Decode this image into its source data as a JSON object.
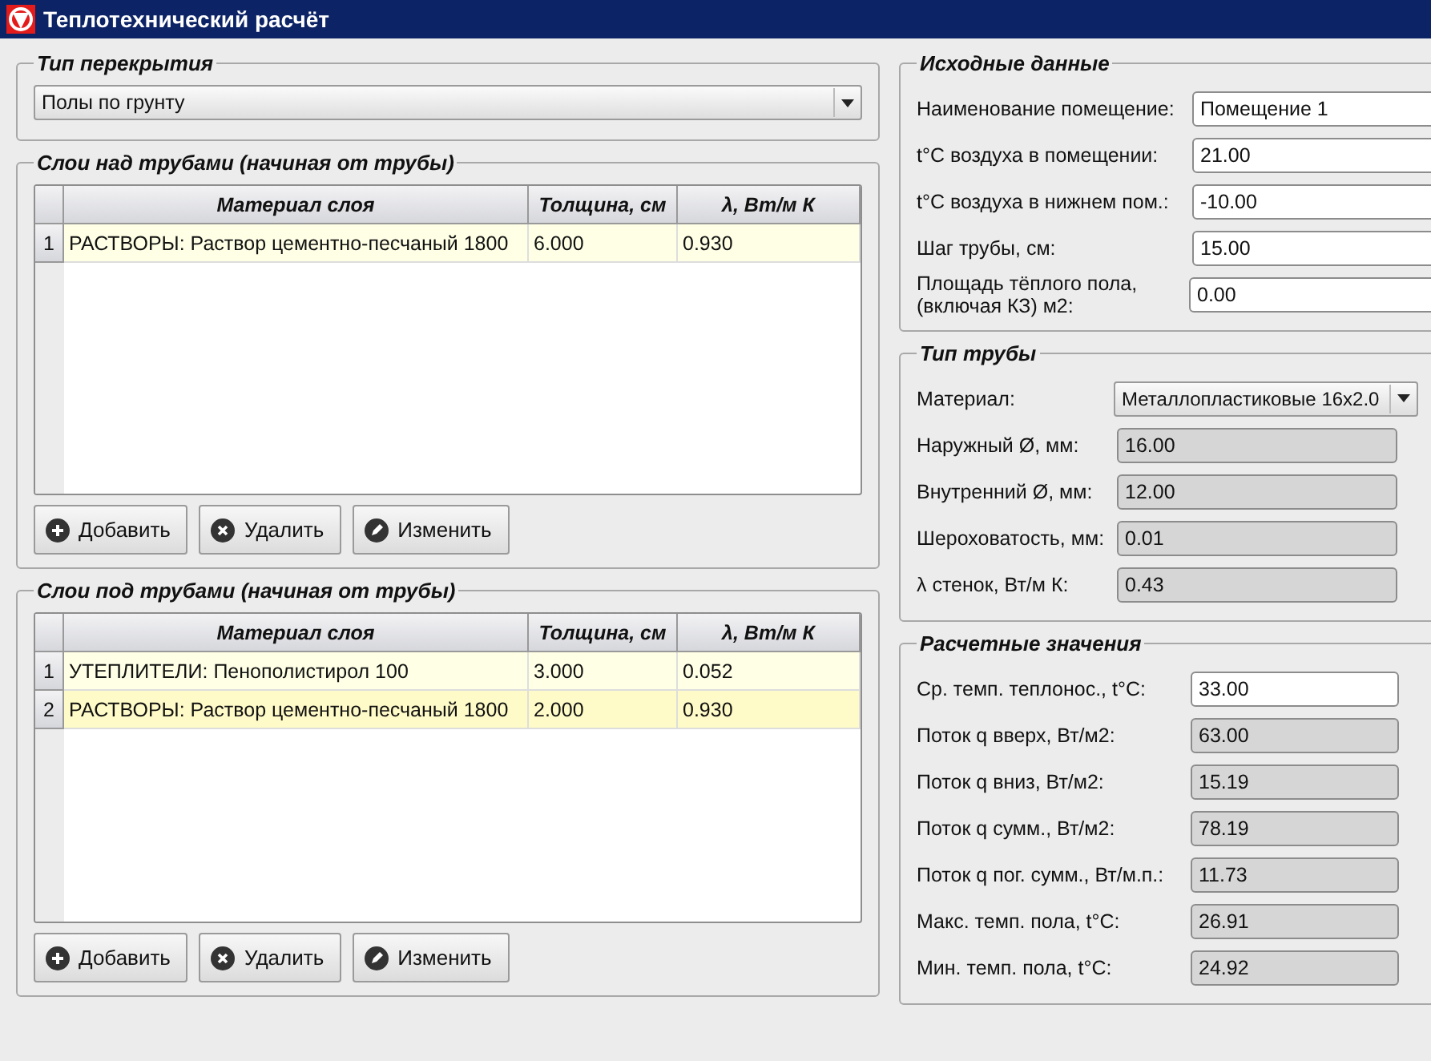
{
  "window": {
    "title": "Теплотехнический расчёт"
  },
  "floor_type": {
    "title": "Тип перекрытия",
    "value": "Полы по грунту"
  },
  "layer_tables": [
    {
      "title": "Слои над трубами (начиная от трубы)",
      "columns": [
        "Материал слоя",
        "Толщина, см",
        "λ, Вт/м К"
      ],
      "rows": [
        {
          "number": "1",
          "cells": [
            "РАСТВОРЫ: Раствор цементно-песчаный 1800",
            "6.000",
            "0.930"
          ],
          "selected": false
        }
      ],
      "buttons": [
        "Добавить",
        "Удалить",
        "Изменить"
      ]
    },
    {
      "title": "Слои под трубами (начиная от трубы)",
      "columns": [
        "Материал слоя",
        "Толщина, см",
        "λ, Вт/м К"
      ],
      "rows": [
        {
          "number": "1",
          "cells": [
            "УТЕПЛИТЕЛИ: Пенополистирол 100",
            "3.000",
            "0.052"
          ],
          "selected": false
        },
        {
          "number": "2",
          "cells": [
            "РАСТВОРЫ: Раствор цементно-песчаный 1800",
            "2.000",
            "0.930"
          ],
          "selected": true
        }
      ],
      "buttons": [
        "Добавить",
        "Удалить",
        "Изменить"
      ]
    }
  ],
  "source_data": {
    "title": "Исходные данные",
    "fields": [
      {
        "label": "Наименование помещение:",
        "value": "Помещение 1",
        "disabled": false
      },
      {
        "label": "t°C воздуха в помещении:",
        "value": "21.00",
        "disabled": false
      },
      {
        "label": "t°C воздуха в нижнем пом.:",
        "value": "-10.00",
        "disabled": false
      },
      {
        "label": "Шаг трубы, см:",
        "value": "15.00",
        "disabled": false
      },
      {
        "label": "Площадь тёплого пола, (включая КЗ) м2:",
        "value": "0.00",
        "disabled": false
      }
    ]
  },
  "pipe_type": {
    "title": "Тип трубы",
    "material_label": "Материал:",
    "material": "Металлопластиковые 16x2.0",
    "fields": [
      {
        "label": "Наружный Ø, мм:",
        "value": "16.00",
        "disabled": true
      },
      {
        "label": "Внутренний Ø, мм:",
        "value": "12.00",
        "disabled": true
      },
      {
        "label": "Шероховатость, мм:",
        "value": "0.01",
        "disabled": true
      },
      {
        "label": "λ стенок, Вт/м К:",
        "value": "0.43",
        "disabled": true
      }
    ]
  },
  "calculated": {
    "title": "Расчетные значения",
    "fields": [
      {
        "label": "Ср. темп. теплонос., t°C:",
        "value": "33.00",
        "disabled": false
      },
      {
        "label": "Поток q вверх, Вт/м2:",
        "value": "63.00",
        "disabled": true
      },
      {
        "label": "Поток q вниз, Вт/м2:",
        "value": "15.19",
        "disabled": true
      },
      {
        "label": "Поток q сумм., Вт/м2:",
        "value": "78.19",
        "disabled": true
      },
      {
        "label": "Поток q пог. сумм., Вт/м.п.:",
        "value": "11.73",
        "disabled": true
      },
      {
        "label": "Макс. темп. пола, t°C:",
        "value": "26.91",
        "disabled": true
      },
      {
        "label": "Мин. темп. пола, t°C:",
        "value": "24.92",
        "disabled": true
      }
    ]
  }
}
